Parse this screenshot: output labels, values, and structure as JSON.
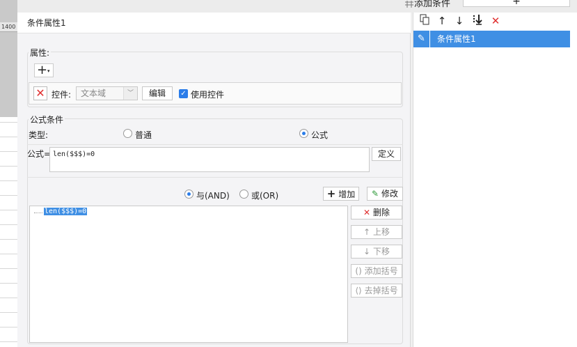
{
  "background": {
    "ruler_label": "1400",
    "top_grid_icon": "grid-icon",
    "top_title": "添加条件",
    "top_add_symbol": "+"
  },
  "dialog": {
    "title": "条件属性1",
    "property_group": {
      "label": "属性:",
      "add_symbol": "+",
      "add_dropdown_symbol": "▾",
      "row": {
        "delete_symbol": "✕",
        "control_label": "控件:",
        "control_value": "文本域",
        "edit_button": "编辑",
        "use_control_checked": true,
        "use_control_label": "使用控件"
      }
    },
    "formula_group": {
      "label": "公式条件",
      "type_label": "类型:",
      "type_options": [
        {
          "label": "普通",
          "selected": false
        },
        {
          "label": "公式",
          "selected": true
        }
      ],
      "formula_label": "公式=",
      "formula_value": "len($$$)=0",
      "define_button": "定义",
      "logic_options": [
        {
          "label": "与(AND)",
          "selected": true
        },
        {
          "label": "或(OR)",
          "selected": false
        }
      ],
      "add_button": "增加",
      "modify_button": "修改",
      "tree_items": [
        "len($$$)=0"
      ],
      "side_buttons": [
        {
          "label": "删除",
          "icon": "✕",
          "enabled": true
        },
        {
          "label": "上移",
          "icon": "↑",
          "enabled": false
        },
        {
          "label": "下移",
          "icon": "↓",
          "enabled": false
        },
        {
          "label": "添加括号",
          "icon": "()",
          "enabled": false
        },
        {
          "label": "去掉括号",
          "icon": "⟨⟩",
          "enabled": false
        }
      ]
    }
  },
  "right_panel": {
    "toolbar": [
      "copy-icon",
      "move-up-icon",
      "move-down-icon",
      "move-bottom-icon",
      "delete-icon"
    ],
    "items": [
      {
        "label": "条件属性1",
        "selected": true
      }
    ]
  },
  "colors": {
    "accent": "#3f8fe4",
    "delete_red": "#e03030",
    "checkbox_blue": "#2b7de9",
    "add_green": "#2e9a3a"
  }
}
